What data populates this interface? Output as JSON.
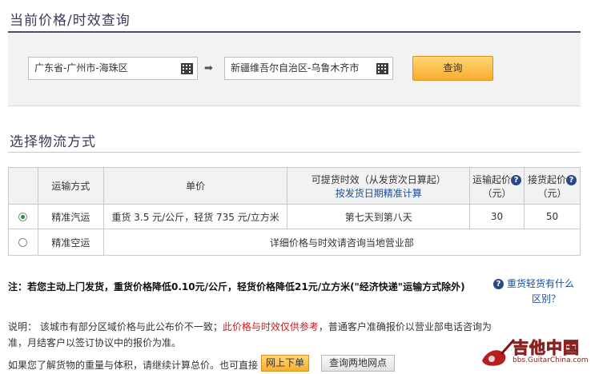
{
  "section1": {
    "title": "当前价格/时效查询"
  },
  "search": {
    "from": "广东省-广州市-海珠区",
    "to": "新疆维吾尔自治区-乌鲁木齐市",
    "arrow": "➡",
    "query_label": "查询"
  },
  "section2": {
    "title": "选择物流方式"
  },
  "table": {
    "headers": {
      "mode": "运输方式",
      "unit_price": "单价",
      "time_line1": "可提货时效（从发货次日算起）",
      "time_link": "按发货日期精准计算",
      "ship_min_line1": "运输起价",
      "ship_min_line2": "（元）",
      "pick_min_line1": "接货起价",
      "pick_min_line2": "（元）"
    },
    "rows": [
      {
        "selected": true,
        "mode": "精准汽运",
        "price": "重货 3.5 元/公斤，轻货 735 元/立方米",
        "time": "第七天到第八天",
        "ship_min": "30",
        "pick_min": "50"
      },
      {
        "selected": false,
        "mode": "精准空运",
        "info": "详细价格与时效请咨询当地营业部"
      }
    ]
  },
  "note": "注：若您主动上门发货，重货价格降低0.10元/公斤，轻货价格降低21元/立方米(\"经济快递\"运输方式除外)",
  "faq": {
    "line1": "重货轻货有什么",
    "line2": "区别？"
  },
  "explain": {
    "prefix": "说明：  该城市有部分区域价格与此公布价不一致；",
    "red": "此价格与时效仅供参考",
    "suffix": "，普通客户准确报价以营业部电话咨询为准，月结客户以签订协议中的报价为准。"
  },
  "bottom": {
    "text": "如果您了解货物的重量与体积，请继续计算总价。也可直接",
    "order_label": "网上下单",
    "nets_label": "查询两地网点"
  },
  "watermark": {
    "main": "吉他中国",
    "sub": "bbs.GuitarChina.com"
  },
  "colors": {
    "accent": "#f9ad2d",
    "title_rule": "#4b4c78",
    "link": "#1a4fa0",
    "warning": "#cc1a1a"
  }
}
